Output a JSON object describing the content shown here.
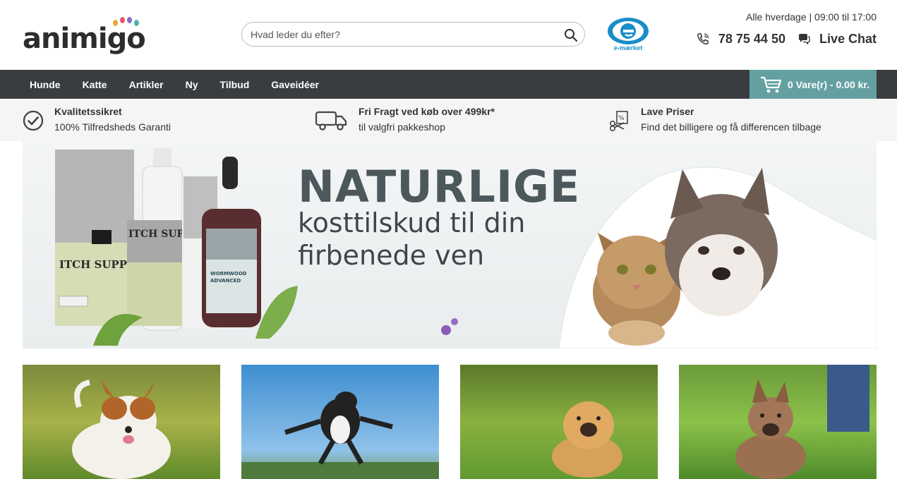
{
  "header": {
    "logo_text": "animigo",
    "search_placeholder": "Hvad leder du efter?",
    "emark_label": "e-mærket",
    "hours": "Alle hverdage | 09:00 til 17:00",
    "phone": "78 75 44 50",
    "live_chat": "Live Chat"
  },
  "nav": {
    "items": [
      "Hunde",
      "Katte",
      "Artikler",
      "Ny",
      "Tilbud",
      "Gaveidéer"
    ],
    "cart_label": "0 Vare(r) - 0.00 kr."
  },
  "usps": [
    {
      "title": "Kvalitetssikret",
      "subtitle": "100% Tilfredsheds Garanti",
      "icon": "check-circle-icon"
    },
    {
      "title": "Fri Fragt ved køb over 499kr*",
      "subtitle": "til valgfri pakkeshop",
      "icon": "truck-icon"
    },
    {
      "title": "Lave Priser",
      "subtitle": "Find det billigere og få differencen tilbage",
      "icon": "price-tag-icon"
    }
  ],
  "banner": {
    "heading": "NATURLIGE",
    "line1": "kosttilskud til din",
    "line2": "firbenede ven",
    "product_labels": [
      "ITCH SUPPORT",
      "ITCH SUPPORT",
      "WORMWOOD ADVANCED"
    ],
    "brand": "animigo"
  },
  "colors": {
    "nav_bg": "#3a3d40",
    "cart_bg": "#65a0a1",
    "usp_bg": "#f5f5f5",
    "emark_blue": "#1a8dc9"
  }
}
